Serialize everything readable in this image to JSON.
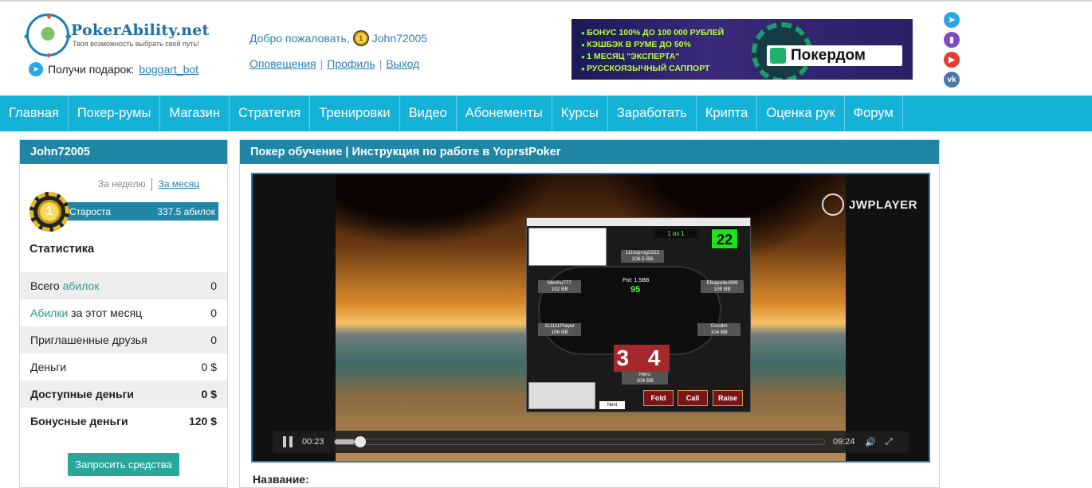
{
  "site": {
    "logo_title": "PokerAbility.net",
    "logo_subtitle": "Твоя возможность выбрать свой путь!",
    "gift_text": "Получи подарок:",
    "gift_link": "boggart_bot"
  },
  "user": {
    "welcome": "Добро пожаловать,",
    "coin_level": "1",
    "username": "John72005",
    "links": [
      "Оповещения",
      "Профиль",
      "Выход"
    ],
    "separators": [
      "|",
      "|"
    ]
  },
  "banner": {
    "lines": [
      "БОНУС 100% ДО 100 000 РУБЛЕЙ",
      "КЭШБЭК В РУМЕ ДО 50%",
      "1 МЕСЯЦ \"ЭКСПЕРТА\"",
      "РУССКОЯЗЫЧНЫЙ САППОРТ"
    ],
    "brand": "Покердом",
    "colors": {
      "text": "#b9ff3b",
      "background": "#2b1f66"
    }
  },
  "socials": [
    {
      "icon": "telegram-icon",
      "glyph": "➤"
    },
    {
      "icon": "twitch-icon",
      "glyph": "▮"
    },
    {
      "icon": "youtube-icon",
      "glyph": "▶"
    },
    {
      "icon": "vk-icon",
      "glyph": "vk"
    }
  ],
  "nav": [
    "Главная",
    "Покер-румы",
    "Магазин",
    "Стратегия",
    "Тренировки",
    "Видео",
    "Абонементы",
    "Курсы",
    "Заработать",
    "Крипта",
    "Оценка рук",
    "Форум"
  ],
  "sidebar": {
    "title": "John72005",
    "period_week": "За неделю",
    "period_month": "За месяц",
    "rank_number": "1",
    "rank_name": "Староста",
    "rank_value": "337.5 абилок",
    "stats_title": "Статистика",
    "stats": [
      {
        "label_pre": "Всего ",
        "label_accent": "абилок",
        "label_post": "",
        "value": "0"
      },
      {
        "label_pre": "",
        "label_accent": "Абилки",
        "label_post": " за этот месяц",
        "value": "0"
      },
      {
        "label_pre": "Приглашенные друзья",
        "label_accent": "",
        "label_post": "",
        "value": "0"
      },
      {
        "label_pre": "Деньги",
        "label_accent": "",
        "label_post": "",
        "value": "0 $"
      },
      {
        "label_pre": "Доступные деньги",
        "label_accent": "",
        "label_post": "",
        "value": "0 $"
      },
      {
        "label_pre": "Бонусные деньги",
        "label_accent": "",
        "label_post": "",
        "value": "120 $"
      }
    ],
    "request_button": "Запросить средства"
  },
  "main": {
    "title": "Покер обучение | Инструкция по работе в YoprstPoker",
    "name_label": "Название:"
  },
  "video": {
    "brand": "JWPLAYER",
    "current_time": "00:23",
    "duration": "09:24",
    "progress": 0.041,
    "poker": {
      "counter": "1 из 1",
      "timer": "22",
      "pot": "Pot: 1.5BB",
      "pot_value": "95",
      "hand": "3 4",
      "hero": "Hero\n104 BB",
      "seats": [
        "111toprog2222\n106.5 BB",
        "Mexhu777\n102 BB",
        "Elkapelku999\n109 BB",
        "111111Player\n106 BB",
        "Goodm\n104 BB"
      ],
      "buttons": [
        "Fold",
        "Call",
        "Raise"
      ],
      "next": "Next"
    }
  }
}
